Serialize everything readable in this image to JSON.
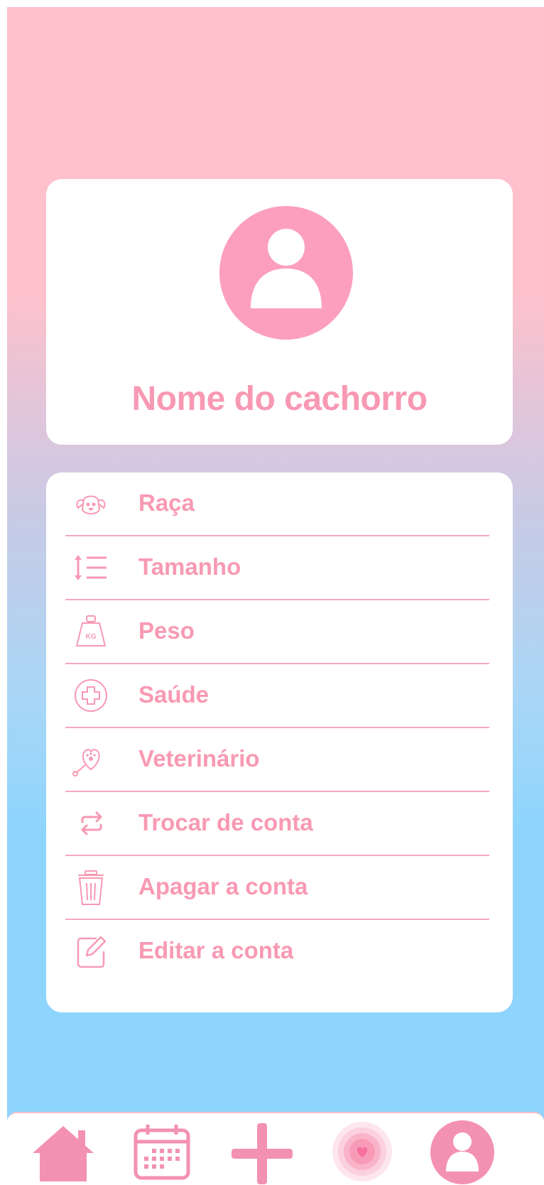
{
  "profile": {
    "dog_name": "Nome do cachorro",
    "avatar_icon": "user-avatar-icon"
  },
  "menu": {
    "items": [
      {
        "label": "Raça",
        "icon": "dog-face-icon"
      },
      {
        "label": "Tamanho",
        "icon": "sort-list-icon"
      },
      {
        "label": "Peso",
        "icon": "kg-weight-icon"
      },
      {
        "label": "Saúde",
        "icon": "health-cross-icon"
      },
      {
        "label": "Veterinário",
        "icon": "stethoscope-paw-icon"
      },
      {
        "label": "Trocar de conta",
        "icon": "swap-arrows-icon"
      },
      {
        "label": "Apagar a conta",
        "icon": "trash-icon"
      },
      {
        "label": "Editar a conta",
        "icon": "edit-pencil-icon"
      }
    ],
    "weight_icon_text": "KG"
  },
  "bottom_nav": {
    "items": [
      {
        "icon": "home-icon"
      },
      {
        "icon": "calendar-icon"
      },
      {
        "icon": "plus-icon"
      },
      {
        "icon": "heart-pulse-icon"
      },
      {
        "icon": "profile-icon"
      }
    ]
  },
  "colors": {
    "accent": "#f899b4",
    "avatar": "#fc9fbe",
    "background_top": "#fec1cb",
    "background_bottom": "#8ed5fd"
  }
}
